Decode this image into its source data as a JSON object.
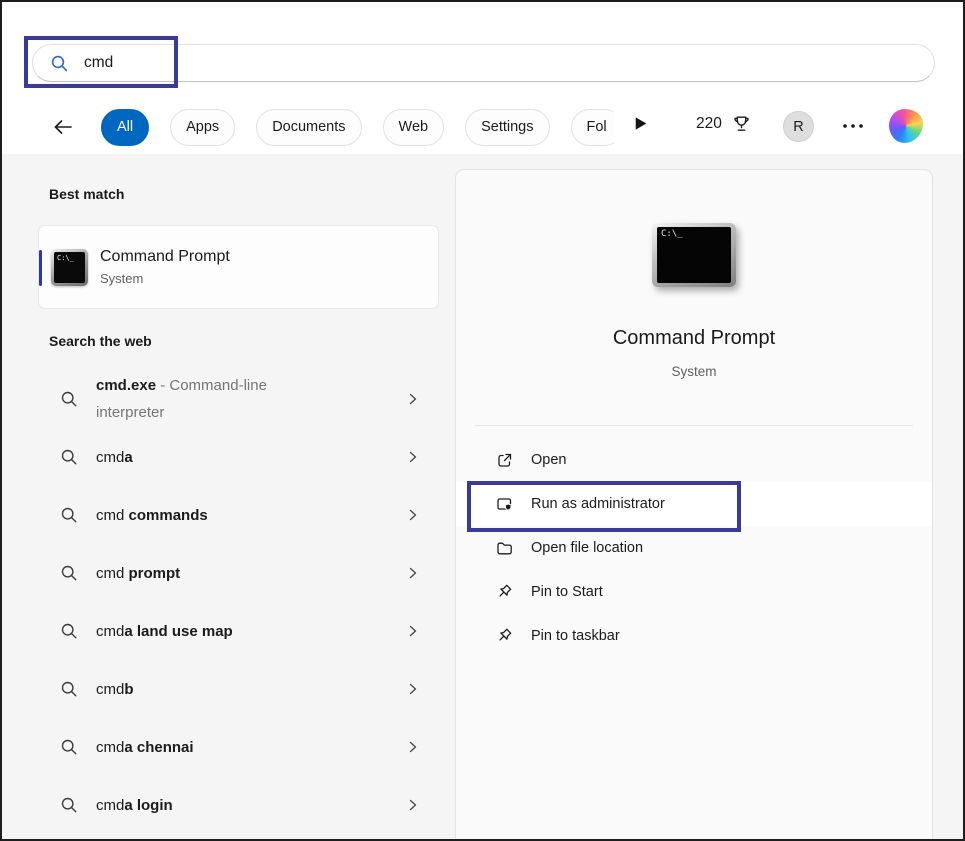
{
  "colors": {
    "annotation": "#3a3a9c",
    "accent": "#0067c0",
    "selection_bar": "#2b3a9b"
  },
  "search": {
    "value": "cmd"
  },
  "filters": {
    "items": [
      {
        "label": "All",
        "active": true
      },
      {
        "label": "Apps"
      },
      {
        "label": "Documents"
      },
      {
        "label": "Web"
      },
      {
        "label": "Settings"
      },
      {
        "label": "Fol"
      }
    ]
  },
  "topbar_right": {
    "rewards_points": "220",
    "avatar_letter": "R"
  },
  "best_match": {
    "heading": "Best match",
    "item": {
      "title": "Command Prompt",
      "subtitle": "System",
      "icon_text": "C:\\_"
    }
  },
  "web_search": {
    "heading": "Search the web",
    "items": [
      {
        "parts": [
          {
            "t": "cmd.exe",
            "bold": true
          },
          {
            "t": " - Command-line",
            "gray": true
          },
          {
            "t": "interpreter",
            "gray": true,
            "br": true
          }
        ]
      },
      {
        "parts": [
          {
            "t": "cmd"
          },
          {
            "t": "a",
            "bold": true
          }
        ]
      },
      {
        "parts": [
          {
            "t": "cmd"
          },
          {
            "t": " commands",
            "bold": true
          }
        ]
      },
      {
        "parts": [
          {
            "t": "cmd"
          },
          {
            "t": " prompt",
            "bold": true
          }
        ]
      },
      {
        "parts": [
          {
            "t": "cmd"
          },
          {
            "t": "a land use map",
            "bold": true
          }
        ]
      },
      {
        "parts": [
          {
            "t": "cmd"
          },
          {
            "t": "b",
            "bold": true
          }
        ]
      },
      {
        "parts": [
          {
            "t": "cmd"
          },
          {
            "t": "a chennai",
            "bold": true
          }
        ]
      },
      {
        "parts": [
          {
            "t": "cmd"
          },
          {
            "t": "a login",
            "bold": true
          }
        ]
      }
    ]
  },
  "preview": {
    "title": "Command Prompt",
    "subtitle": "System",
    "icon_text": "C:\\_",
    "actions": [
      {
        "label": "Open",
        "icon": "open"
      },
      {
        "label": "Run as administrator",
        "icon": "run-admin",
        "highlighted": true
      },
      {
        "label": "Open file location",
        "icon": "folder"
      },
      {
        "label": "Pin to Start",
        "icon": "pin"
      },
      {
        "label": "Pin to taskbar",
        "icon": "pin"
      }
    ]
  }
}
